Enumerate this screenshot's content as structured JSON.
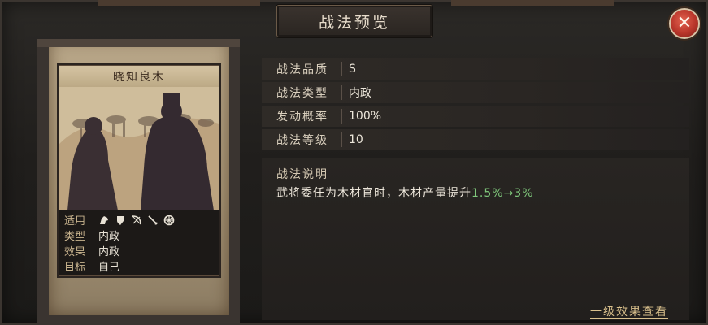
{
  "window": {
    "title": "战法预览",
    "close_icon": "close-icon"
  },
  "card": {
    "name": "晓知良木",
    "info": [
      {
        "label": "适用",
        "icons": [
          "cavalry-icon",
          "shield-icon",
          "bow-icon",
          "spear-icon",
          "wheel-icon"
        ]
      },
      {
        "label": "类型",
        "value": "内政"
      },
      {
        "label": "效果",
        "value": "内政"
      },
      {
        "label": "目标",
        "value": "自己"
      }
    ]
  },
  "attributes": [
    {
      "label": "战法品质",
      "value": "S"
    },
    {
      "label": "战法类型",
      "value": "内政"
    },
    {
      "label": "发动概率",
      "value": "100%"
    },
    {
      "label": "战法等级",
      "value": "10"
    }
  ],
  "description": {
    "title": "战法说明",
    "text_prefix": "武将委任为木材官时，木材产量提升",
    "text_highlight": "1.5%→3%"
  },
  "footer": {
    "link_label": "一级效果查看"
  },
  "colors": {
    "highlight": "#7fc77b",
    "link": "#d9c08c",
    "close_red": "#b8352a"
  }
}
